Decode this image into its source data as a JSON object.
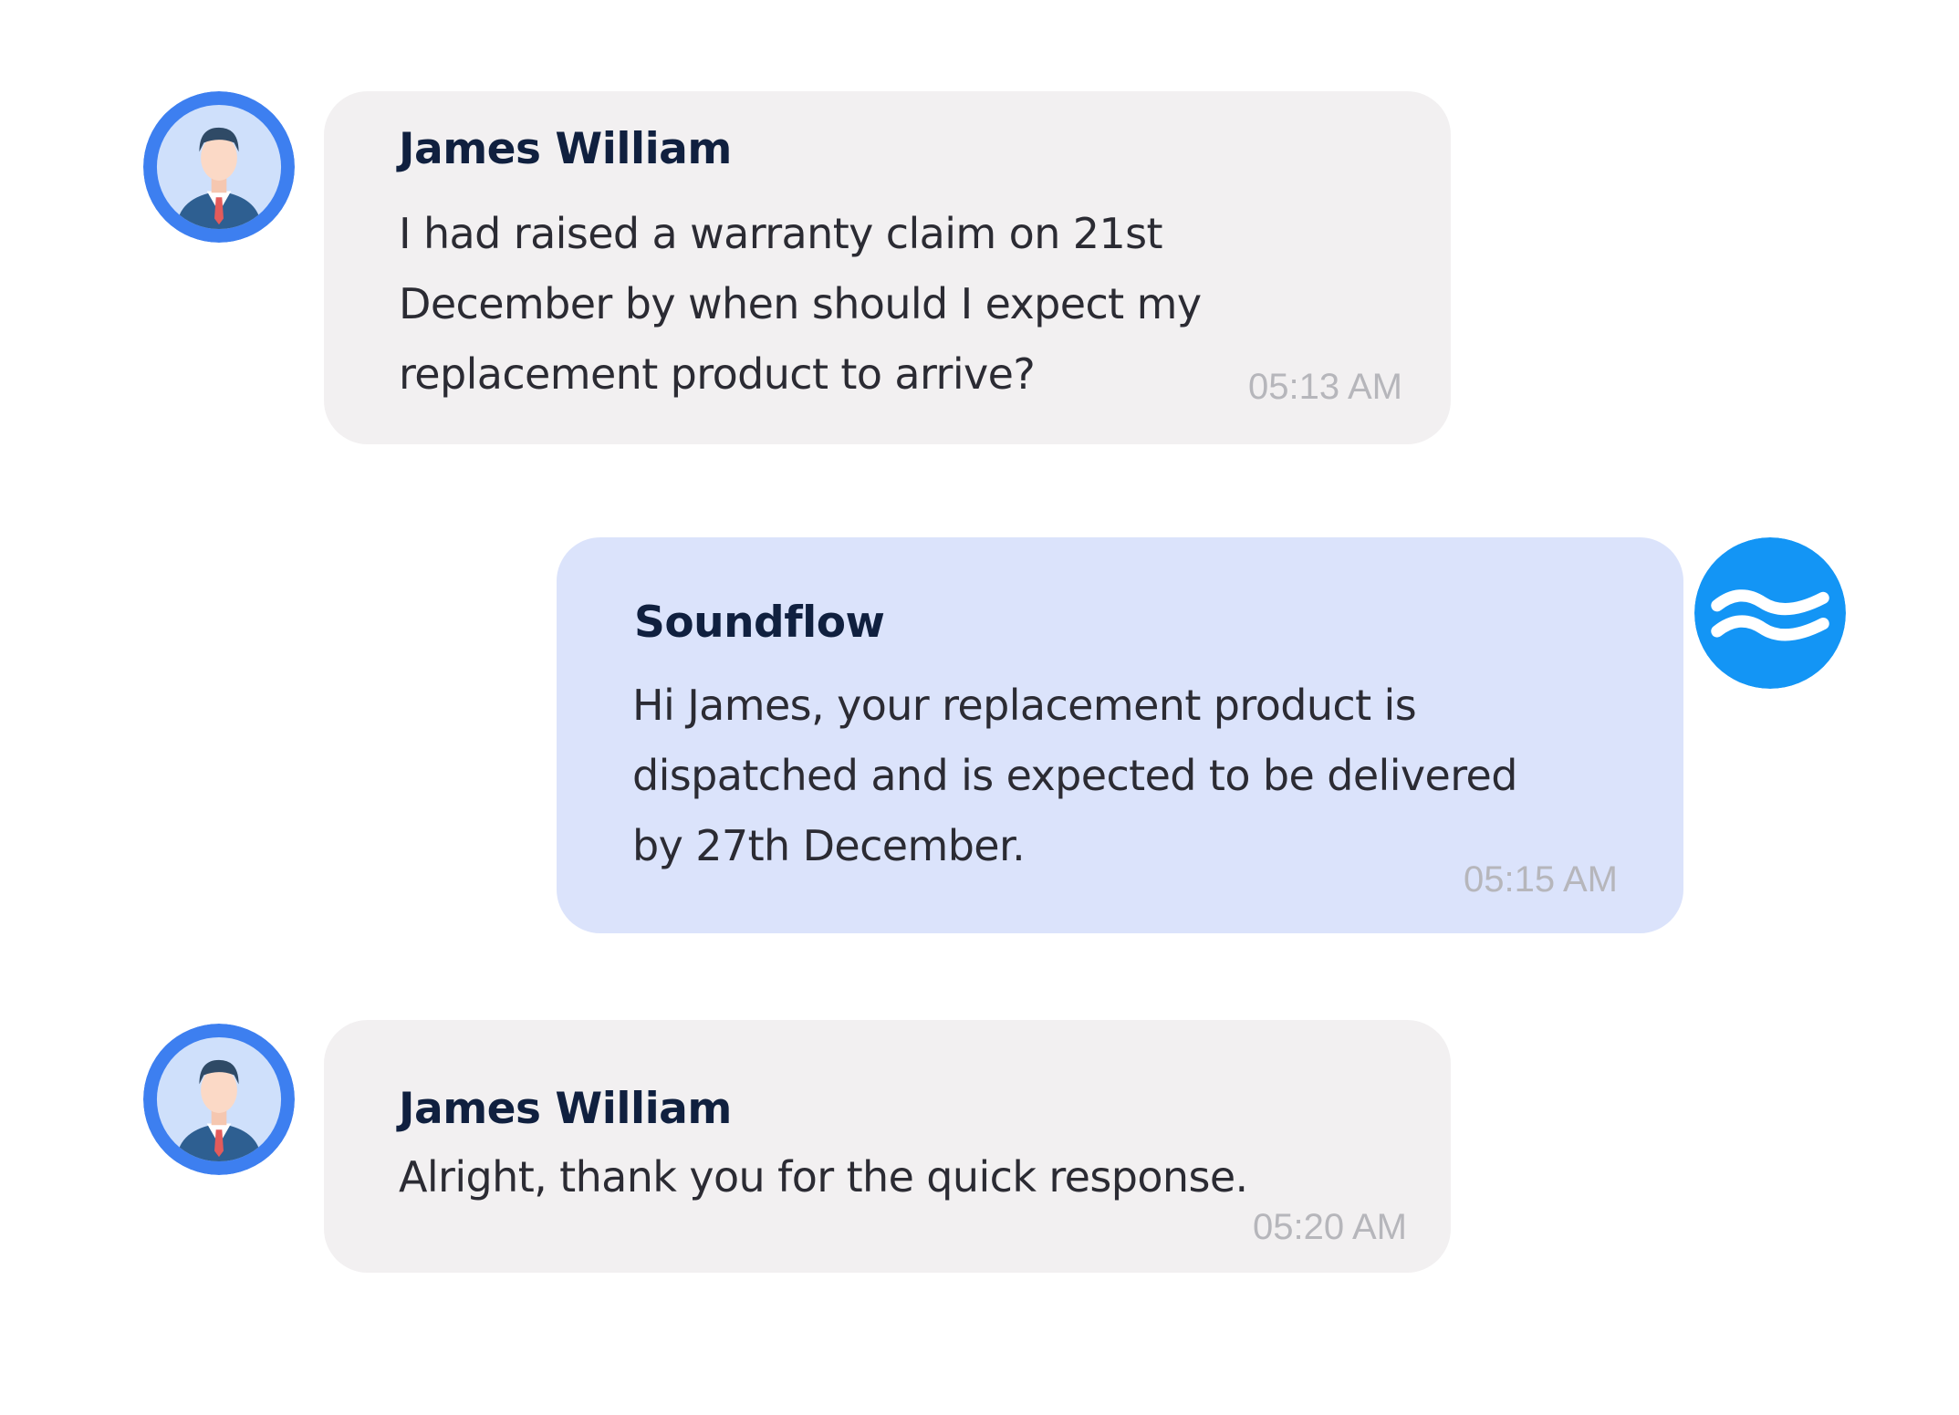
{
  "messages": [
    {
      "sender": "James William",
      "lines": [
        "I had raised a warranty claim on 21st",
        "December by when should I expect my",
        "replacement product to arrive?"
      ],
      "time": "05:13 AM"
    },
    {
      "sender": "Soundflow",
      "lines": [
        "Hi James, your replacement product is",
        "dispatched and is expected to be delivered",
        "by 27th December."
      ],
      "time": "05:15 AM"
    },
    {
      "sender": "James William",
      "lines": [
        "Alright, thank you for the quick response."
      ],
      "time": "05:20 AM"
    }
  ],
  "icons": {
    "user_avatar": "user-avatar-icon",
    "brand_logo": "soundflow-wave-icon"
  },
  "colors": {
    "user_bubble": "#f2f0f1",
    "bot_bubble": "#dbe3fb",
    "avatar_ring": "#3d7ff0",
    "brand_blue": "#1395f5",
    "sender_text": "#10203f",
    "body_text": "#2b2b33",
    "time_text": "#b6b6bb"
  }
}
